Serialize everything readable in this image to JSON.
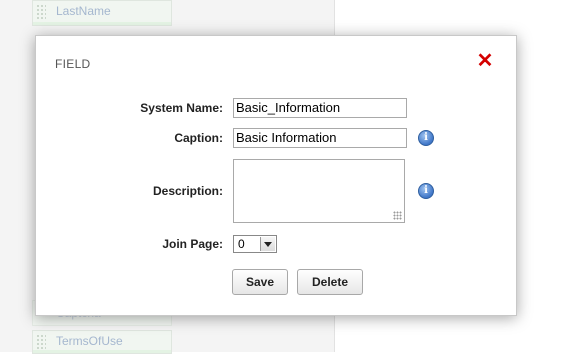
{
  "background": {
    "fields": [
      "LastName",
      "TermsOfUse"
    ],
    "ghost_field": "Captcha"
  },
  "dialog": {
    "title": "FIELD",
    "close_icon": "close-x-icon",
    "system_name": {
      "label": "System Name:",
      "value": "Basic_Information"
    },
    "caption": {
      "label": "Caption:",
      "value": "Basic Information",
      "icon": "info-icon"
    },
    "description": {
      "label": "Description:",
      "value": "",
      "icon": "info-icon"
    },
    "join_page": {
      "label": "Join Page:",
      "value": "0"
    },
    "buttons": {
      "save": "Save",
      "delete": "Delete"
    }
  },
  "colors": {
    "close": "#d40000",
    "info": "#3f76c8"
  }
}
